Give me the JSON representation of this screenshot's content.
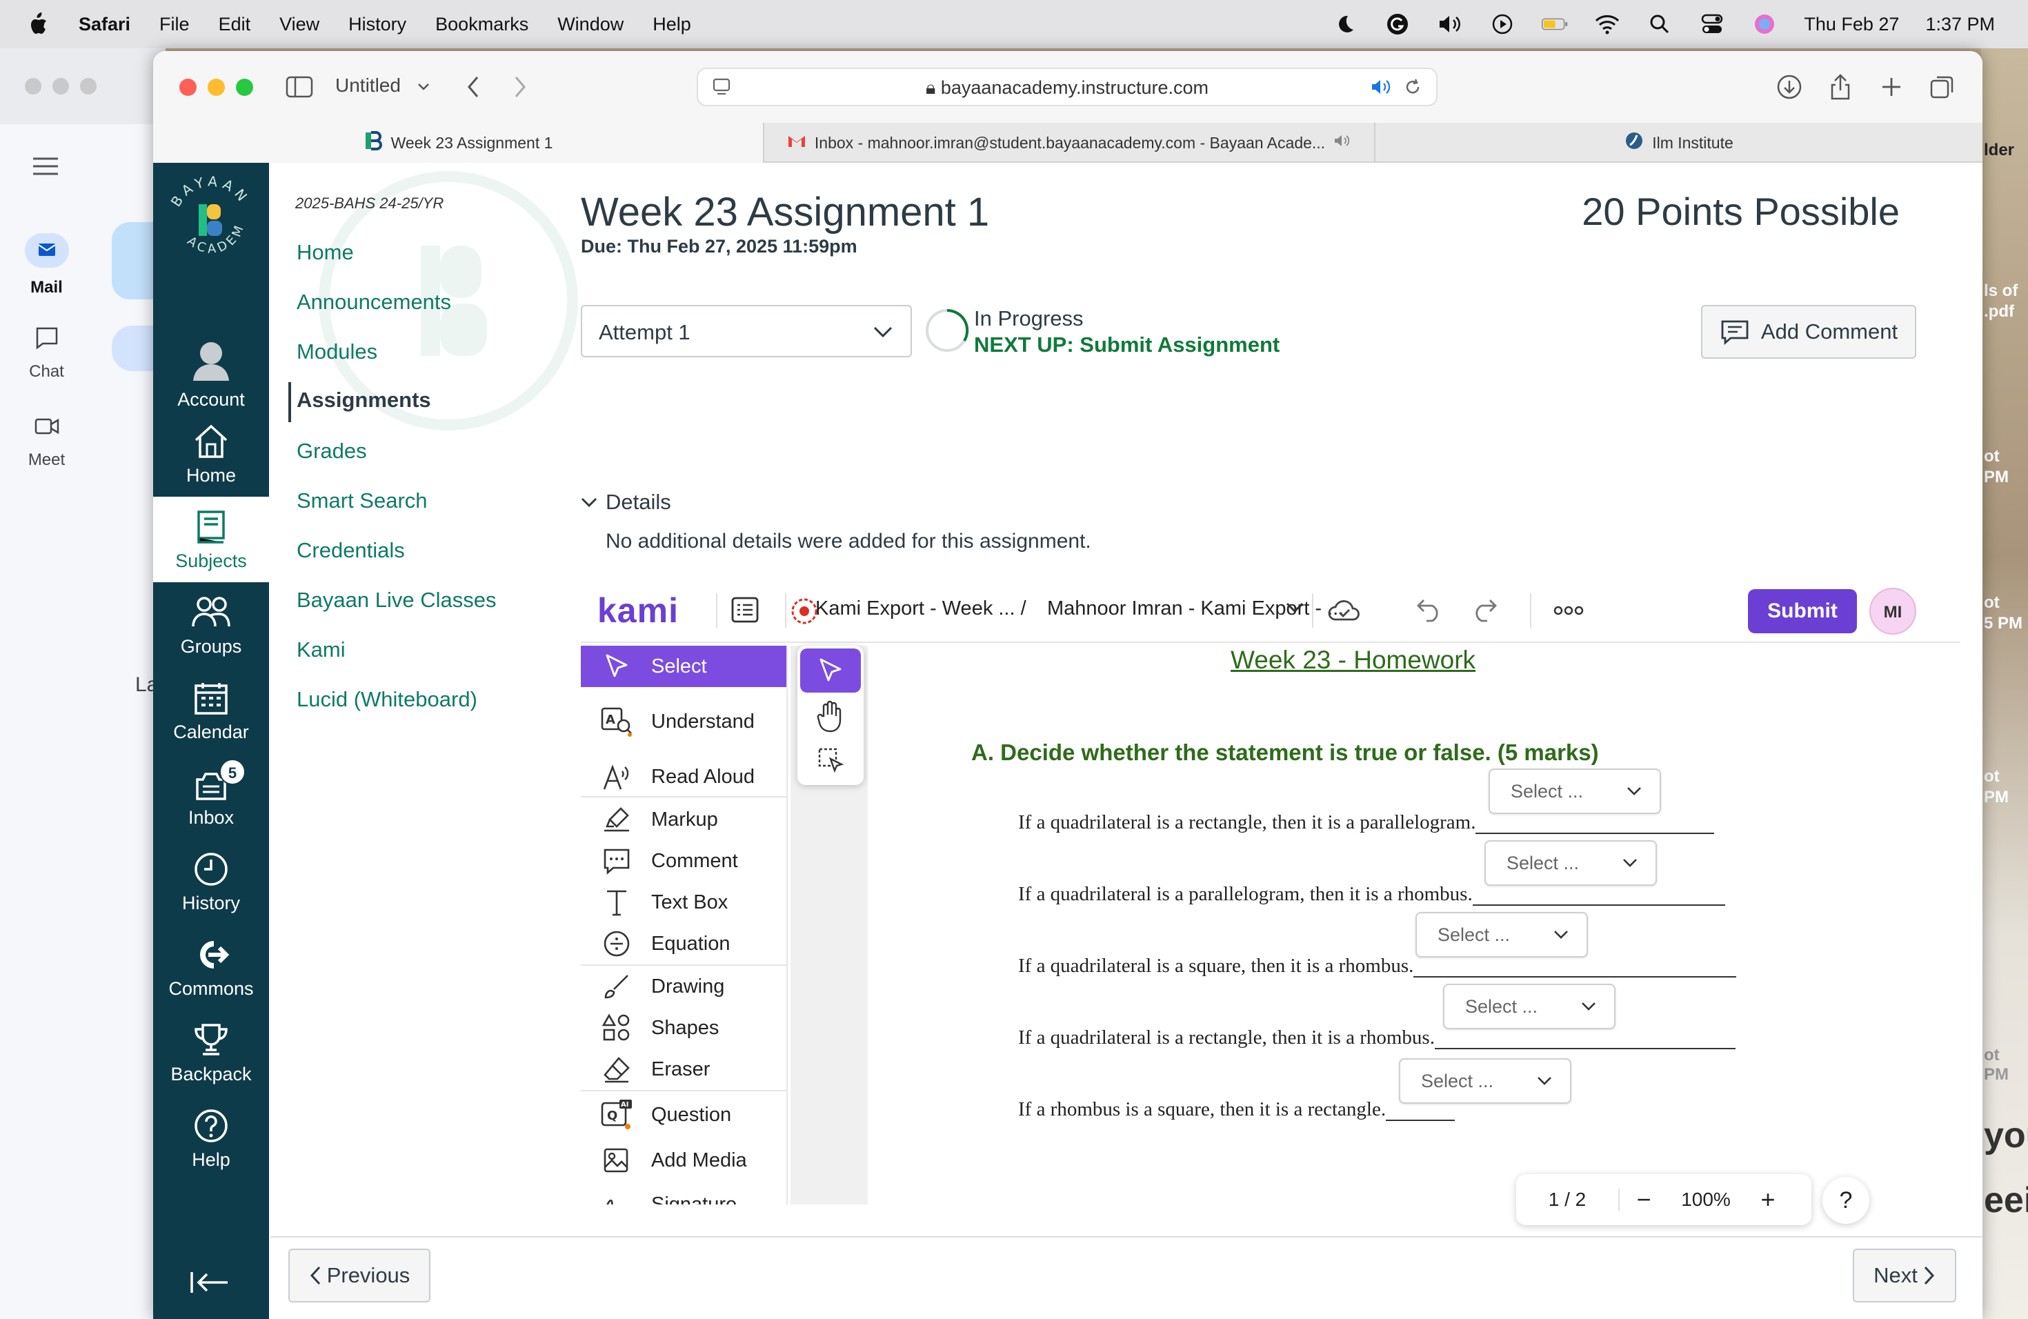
{
  "menubar": {
    "app": "Safari",
    "items": [
      "File",
      "Edit",
      "View",
      "History",
      "Bookmarks",
      "Window",
      "Help"
    ],
    "date": "Thu Feb 27",
    "time": "1:37 PM"
  },
  "gmail_bg": {
    "items": [
      {
        "label": "Mail"
      },
      {
        "label": "Chat"
      },
      {
        "label": "Meet"
      }
    ],
    "side_text": "La"
  },
  "right_bg": {
    "texts": [
      "lder",
      "ls of",
      ".pdf",
      "ot",
      "PM",
      "ot",
      "5 PM",
      "ot",
      "PM",
      "ot",
      "PM",
      "you",
      "eei"
    ]
  },
  "safari": {
    "tab_group": "Untitled",
    "url": "bayaanacademy.instructure.com",
    "tabs": [
      {
        "label": "Week 23 Assignment 1"
      },
      {
        "label": "Inbox - mahnoor.imran@student.bayaanacademy.com - Bayaan Acade..."
      },
      {
        "label": "Ilm Institute"
      }
    ]
  },
  "global_nav": {
    "items": [
      {
        "label": "Account"
      },
      {
        "label": "Home"
      },
      {
        "label": "Subjects"
      },
      {
        "label": "Groups"
      },
      {
        "label": "Calendar"
      },
      {
        "label": "Inbox",
        "badge": "5"
      },
      {
        "label": "History"
      },
      {
        "label": "Commons"
      },
      {
        "label": "Backpack"
      },
      {
        "label": "Help"
      }
    ]
  },
  "course_nav": {
    "term": "2025-BAHS 24-25/YR",
    "links": [
      "Home",
      "Announcements",
      "Modules",
      "Assignments",
      "Grades",
      "Smart Search",
      "Credentials",
      "Bayaan Live Classes",
      "Kami",
      "Lucid (Whiteboard)"
    ]
  },
  "assignment": {
    "title": "Week 23 Assignment 1",
    "due": "Due: Thu Feb 27, 2025 11:59pm",
    "points": "20 Points Possible",
    "attempt": "Attempt 1",
    "status": "In Progress",
    "next_up": "NEXT UP: Submit Assignment",
    "add_comment": "Add Comment",
    "details_label": "Details",
    "details_text": "No additional details were added for this assignment."
  },
  "kami": {
    "logo": "kami",
    "doc_name": "Kami Export - Week ... /",
    "doc_name2": "Mahnoor Imran - Kami Export - ...",
    "submit": "Submit",
    "avatar": "MI",
    "tools": [
      "Select",
      "Understand",
      "Read Aloud",
      "Markup",
      "Comment",
      "Text Box",
      "Equation",
      "Drawing",
      "Shapes",
      "Eraser",
      "Question",
      "Add Media",
      "Signature"
    ],
    "page_indicator": "1 / 2",
    "zoom": "100%",
    "zoom_minus": "−",
    "zoom_plus": "+",
    "help": "?"
  },
  "document": {
    "title": "Week 23 - Homework",
    "section": "A.  Decide whether the statement is true or false.  (5 marks)",
    "select_placeholder": "Select ...",
    "questions": [
      "If a quadrilateral is a rectangle, then it is a parallelogram.",
      "If a quadrilateral is a parallelogram, then it is a rhombus.",
      "If a quadrilateral is a square, then it is a rhombus.",
      "If a quadrilateral is a rectangle, then it is a rhombus.",
      "If a rhombus is a square, then it is a rectangle."
    ]
  },
  "footer": {
    "previous": "Previous",
    "next": "Next"
  },
  "colors": {
    "canvas_nav": "#0e3b4a",
    "link": "#0e7a67",
    "kami_purple": "#6b3fd4",
    "doc_green": "#2e6b1a"
  }
}
